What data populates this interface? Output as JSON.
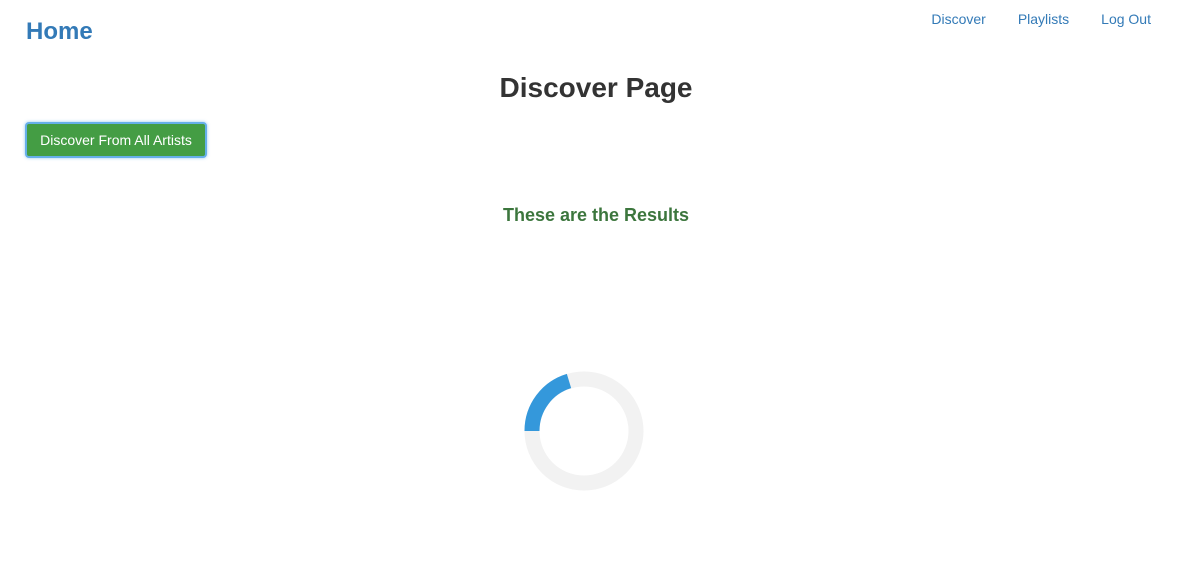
{
  "header": {
    "brand_label": "Home",
    "nav": [
      {
        "label": "Discover"
      },
      {
        "label": "Playlists"
      },
      {
        "label": "Log Out"
      }
    ]
  },
  "main": {
    "page_title": "Discover Page",
    "discover_button_label": "Discover From All Artists",
    "results_heading": "These are the Results"
  },
  "loading": {
    "icon": "loading-spinner-icon",
    "track_color": "#f2f2f2",
    "arc_color": "#3498db"
  },
  "colors": {
    "link": "#337ab7",
    "button_bg": "#449d44",
    "results_text": "#3c763d"
  }
}
